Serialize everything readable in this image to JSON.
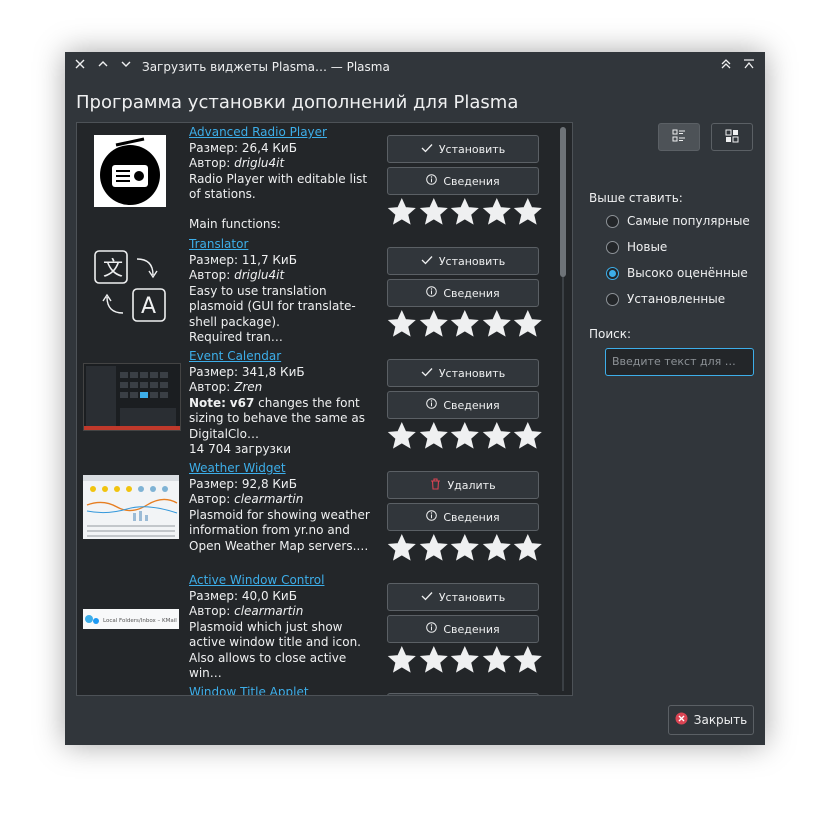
{
  "window": {
    "title": "Загрузить виджеты Plasma… — Plasma",
    "heading": "Программа установки дополнений для Plasma"
  },
  "items": [
    {
      "name": "Advanced Radio Player",
      "size": "Размер: 26,4 КиБ",
      "author_prefix": "Автор: ",
      "author": "driglu4it",
      "description": "Radio Player with editable list of stations.",
      "extra": " Main functions:",
      "primary_action": "Установить",
      "primary_icon": "check-icon",
      "details_action": "Сведения",
      "rating": 5
    },
    {
      "name": "Translator",
      "size": "Размер: 11,7 КиБ",
      "author_prefix": "Автор: ",
      "author": "driglu4it",
      "description": "Easy to use translation plasmoid (GUI for translate-shell package).",
      "extra": " Required tran…",
      "primary_action": "Установить",
      "primary_icon": "check-icon",
      "details_action": "Сведения",
      "rating": 5
    },
    {
      "name": "Event Calendar",
      "size": "Размер: 341,8 КиБ",
      "author_prefix": "Автор: ",
      "author": "Zren",
      "note_label": "Note:",
      "note_version": "v67",
      "description": " changes the font sizing to behave the same as DigitalClo…",
      "downloads": "14 704 загрузки",
      "primary_action": "Установить",
      "primary_icon": "check-icon",
      "details_action": "Сведения",
      "rating": 5
    },
    {
      "name": "Weather Widget",
      "size": "Размер: 92,8 КиБ",
      "author_prefix": "Автор: ",
      "author": "clearmartin",
      "description": "Plasmoid for showing weather information from yr.no and Open Weather Map servers.…",
      "primary_action": "Удалить",
      "primary_icon": "trash-icon",
      "details_action": "Сведения",
      "rating": 5
    },
    {
      "name": "Active Window Control",
      "size": "Размер: 40,0 КиБ",
      "author_prefix": "Автор: ",
      "author": "clearmartin",
      "description": "Plasmoid which just show active window title and icon. Also allows to close active win…",
      "thumb_text": "Local Folders/Inbox – KMail",
      "primary_action": "Установить",
      "primary_icon": "check-icon",
      "details_action": "Сведения",
      "rating": 5
    },
    {
      "name": "Window Title Applet"
    }
  ],
  "sidebar": {
    "sort_label": "Выше ставить:",
    "sort_options": [
      {
        "label": "Самые популярные",
        "checked": false
      },
      {
        "label": "Новые",
        "checked": false
      },
      {
        "label": "Высоко оценённые",
        "checked": true
      },
      {
        "label": "Установленные",
        "checked": false
      }
    ],
    "search_label": "Поиск:",
    "search_placeholder": "Введите текст для …"
  },
  "footer": {
    "close_label": "Закрыть"
  },
  "colors": {
    "window_bg": "#31363b",
    "list_bg": "#232629",
    "accent": "#3daee9",
    "text": "#eff0f1",
    "danger": "#da4453"
  }
}
